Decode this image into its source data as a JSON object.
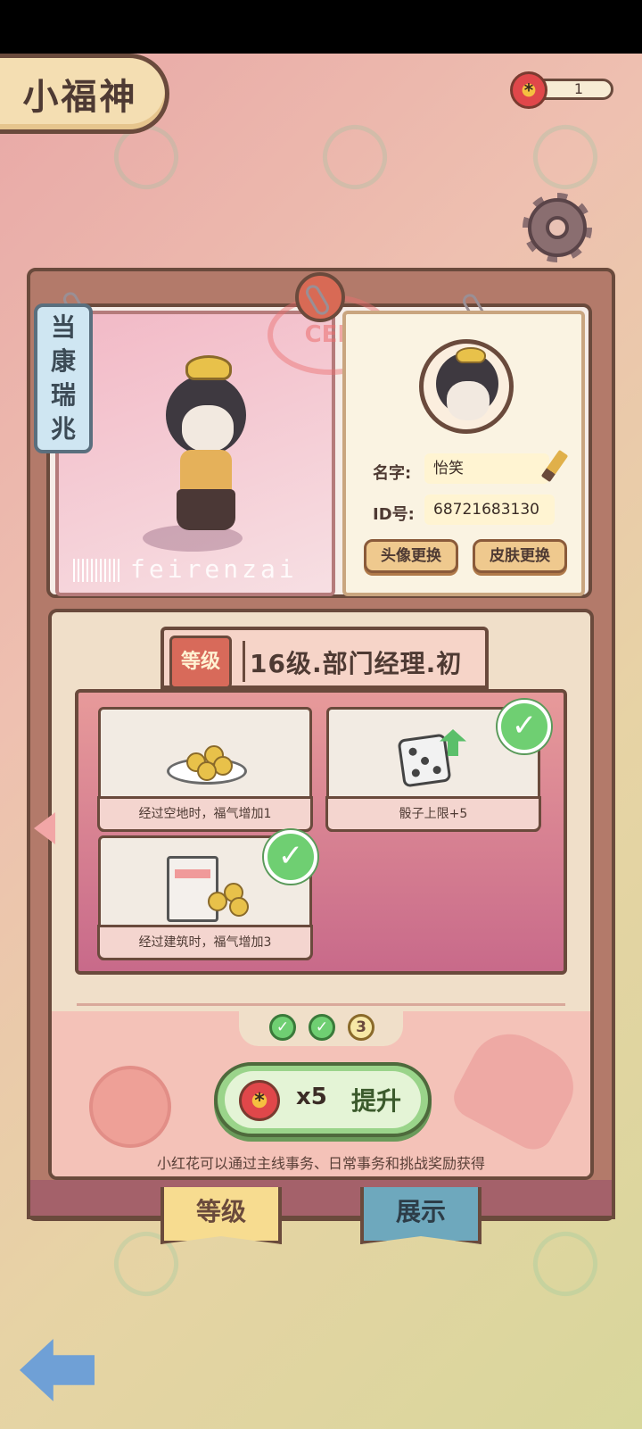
{
  "header": {
    "title": "小福神",
    "flower_count": "1"
  },
  "profile": {
    "vertical_tag": [
      "当",
      "康",
      "瑞",
      "兆"
    ],
    "watermark": "feirenzai",
    "stamp_text": "CER",
    "name_label": "名字:",
    "name_value": "怡笑",
    "id_label": "ID号:",
    "id_value": "68721683130",
    "avatar_button": "头像更换",
    "skin_button": "皮肤更换"
  },
  "level": {
    "tag": "等级",
    "title": "16级.部门经理.初",
    "rewards": [
      {
        "label": "经过空地时，福气增加1",
        "claimed": false,
        "icon": "coins-plate-icon"
      },
      {
        "label": "骰子上限+5",
        "claimed": true,
        "icon": "dice-up-icon"
      },
      {
        "label": "经过建筑时，福气增加3",
        "claimed": true,
        "icon": "building-coins-icon"
      }
    ],
    "progress_steps": [
      "✓",
      "✓",
      "3"
    ],
    "upgrade_cost": "x5",
    "upgrade_label": "提升",
    "hint": "小红花可以通过主线事务、日常事务和挑战奖励获得"
  },
  "tabs": {
    "level": "等级",
    "show": "展示"
  },
  "flower_symbol": "*",
  "colors": {
    "accent_green": "#9ad48a",
    "check_green": "#6fcf72",
    "outline_brown": "#6a4a3c",
    "tab_blue": "#6ea8bd",
    "tab_yellow": "#f7dc90"
  }
}
